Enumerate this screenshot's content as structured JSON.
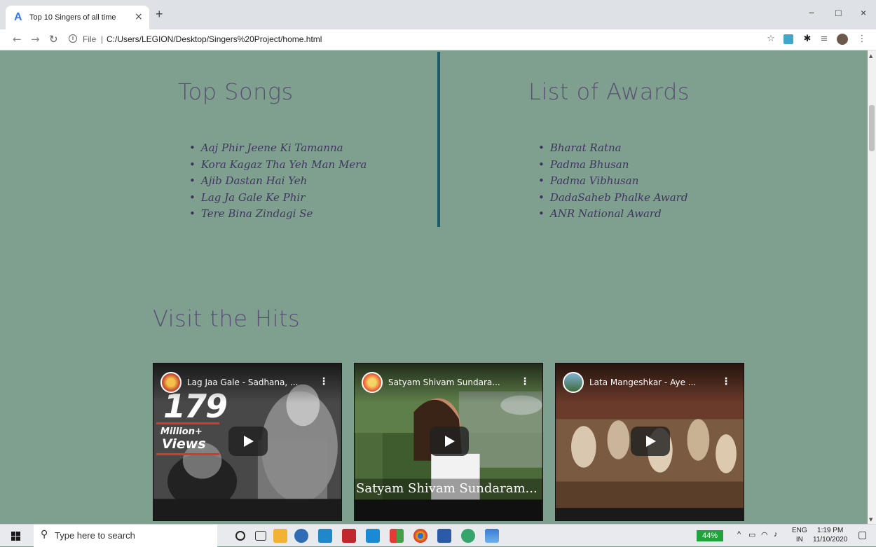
{
  "browser": {
    "tab_title": "Top 10 Singers of all time",
    "tab_close": "×",
    "new_tab": "+",
    "address_scheme": "File",
    "address_url": "C:/Users/LEGION/Desktop/Singers%20Project/home.html",
    "window_controls": [
      "−",
      "□",
      "×"
    ]
  },
  "page": {
    "top_songs_heading": "Top Songs",
    "top_songs": [
      "Aaj Phir Jeene Ki Tamanna",
      "Kora Kagaz Tha Yeh Man Mera",
      "Ajib Dastan Hai Yeh",
      "Lag Ja Gale Ke Phir",
      "Tere Bina Zindagi Se"
    ],
    "awards_heading": "List of Awards",
    "awards": [
      "Bharat Ratna",
      "Padma Bhusan",
      "Padma Vibhusan",
      "DadaSaheb Phalke Award",
      "ANR National Award"
    ],
    "hits_heading": "Visit the Hits",
    "videos": [
      {
        "title": "Lag Jaa Gale - Sadhana, ...",
        "big_number": "179",
        "million_label": "Million+",
        "views_label": "Views"
      },
      {
        "title": "Satyam Shivam Sundara...",
        "overlay_text": "Satyam Shivam Sundaram..."
      },
      {
        "title": "Lata Mangeshkar - Aye ..."
      }
    ]
  },
  "taskbar": {
    "search_placeholder": "Type here to search",
    "battery": "44%",
    "lang_line1": "ENG",
    "lang_line2": "IN",
    "time": "1:19 PM",
    "date": "11/10/2020"
  },
  "colors": {
    "page_background": "#7fa08e",
    "heading_color": "#5a4f75",
    "divider_color": "#1e5b6a",
    "list_text": "#3f3560"
  },
  "icons": [
    "favicon-a-icon",
    "back-arrow-icon",
    "forward-arrow-icon",
    "reload-icon",
    "info-icon",
    "star-icon",
    "extension-icon",
    "puzzle-icon",
    "reading-list-icon",
    "profile-avatar-icon",
    "more-menu-icon",
    "windows-start-icon",
    "search-icon",
    "play-icon"
  ]
}
